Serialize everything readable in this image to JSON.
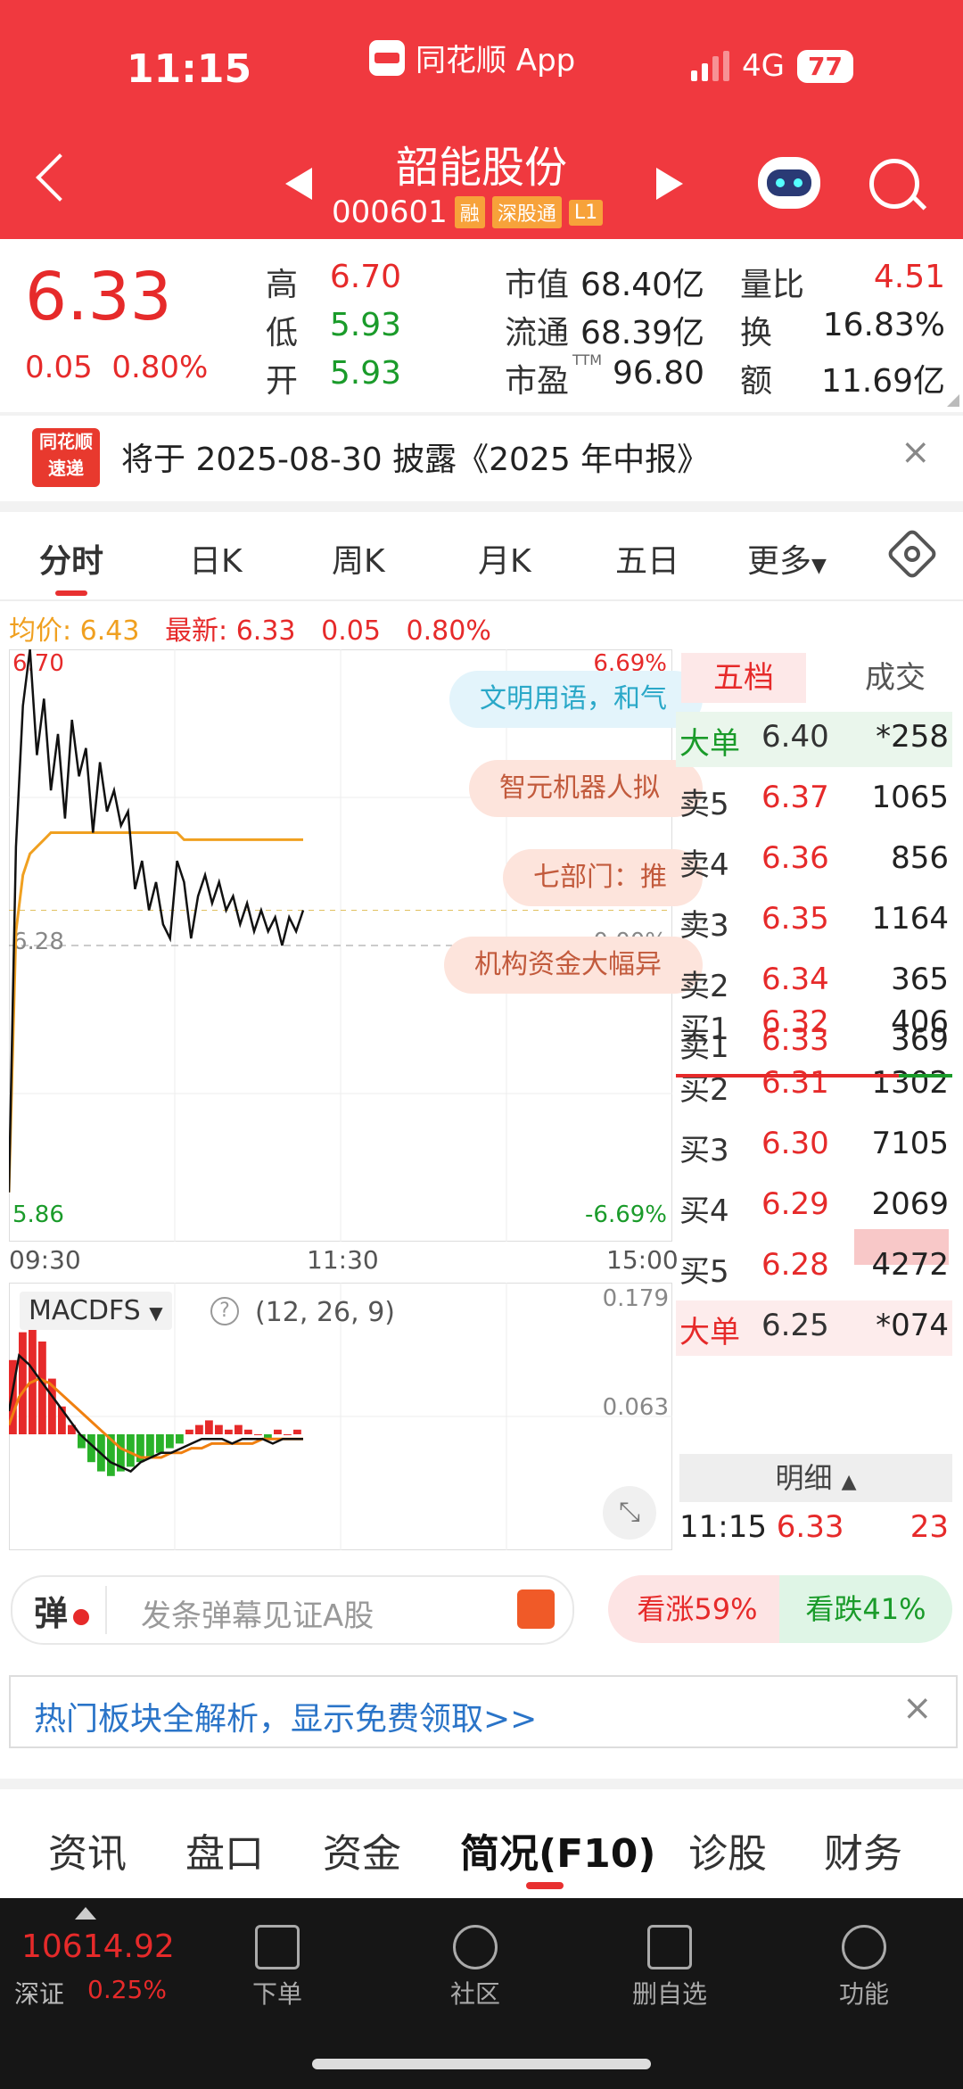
{
  "status_bar": {
    "time": "11:15",
    "app_name": "同花顺 App",
    "network": "4G",
    "battery": "77"
  },
  "header": {
    "stock_name": "韶能股份",
    "stock_code": "000601",
    "tags": [
      "融",
      "深股通",
      "L1"
    ]
  },
  "quote": {
    "price": "6.33",
    "change": "0.05",
    "change_pct": "0.80%",
    "stats": [
      {
        "label": "高",
        "value": "6.70",
        "color": "#e62a2a"
      },
      {
        "label": "低",
        "value": "5.93",
        "color": "#1a9b2a"
      },
      {
        "label": "开",
        "value": "5.93",
        "color": "#1a9b2a"
      },
      {
        "label": "市值",
        "value": "68.40亿"
      },
      {
        "label": "流通",
        "value": "68.39亿"
      },
      {
        "label": "市盈",
        "sup": "TTM",
        "value": "96.80"
      },
      {
        "label": "量比",
        "value": "4.51",
        "color": "#e62a2a"
      },
      {
        "label": "换",
        "value": "16.83%"
      },
      {
        "label": "额",
        "value": "11.69亿"
      }
    ]
  },
  "notice": {
    "logo_line1": "同花顺",
    "logo_line2": "速递",
    "text": "将于 2025-08-30 披露《2025 年中报》"
  },
  "tabs": [
    "分时",
    "日K",
    "周K",
    "月K",
    "五日",
    "更多"
  ],
  "chart_header": {
    "avg_label": "均价: 6.43",
    "latest_label": "最新: 6.33",
    "change": "0.05",
    "change_pct": "0.80%"
  },
  "chart_data": [
    {
      "type": "line",
      "y_top_label": "6.70",
      "y_mid_label": "6.28",
      "y_bottom_label": "5.86",
      "pct_top_label": "6.69%",
      "pct_mid_label": "0.00%",
      "pct_bottom_label": "-6.69%",
      "x_labels": [
        "09:30",
        "11:30",
        "15:00"
      ],
      "ylim": [
        5.86,
        6.7
      ],
      "series": [
        {
          "values": [
            5.93,
            6.42,
            6.62,
            6.7,
            6.55,
            6.63,
            6.5,
            6.58,
            6.46,
            6.6,
            6.52,
            6.56,
            6.44,
            6.54,
            6.47,
            6.5,
            6.45,
            6.47,
            6.36,
            6.4,
            6.33,
            6.37,
            6.31,
            6.29,
            6.4,
            6.37,
            6.29,
            6.35,
            6.38,
            6.34,
            6.37,
            6.33,
            6.35,
            6.31,
            6.34,
            6.3,
            6.33,
            6.3,
            6.32,
            6.28,
            6.32,
            6.3,
            6.33
          ]
        },
        {
          "values": [
            5.93,
            6.3,
            6.38,
            6.41,
            6.42,
            6.43,
            6.44,
            6.44,
            6.44,
            6.44,
            6.44,
            6.44,
            6.44,
            6.44,
            6.44,
            6.44,
            6.44,
            6.44,
            6.44,
            6.44,
            6.44,
            6.44,
            6.44,
            6.44,
            6.44,
            6.43,
            6.43,
            6.43,
            6.43,
            6.43,
            6.43,
            6.43,
            6.43,
            6.43,
            6.43,
            6.43,
            6.43,
            6.43,
            6.43,
            6.43,
            6.43,
            6.43,
            6.43
          ]
        }
      ]
    },
    {
      "type": "bar",
      "title": "MACDFS",
      "params": "(12, 26, 9)",
      "y_labels": [
        "0.179",
        "0.063"
      ],
      "histogram": [
        0.16,
        0.22,
        0.24,
        0.2,
        0.12,
        0.06,
        0.02,
        -0.03,
        -0.06,
        -0.08,
        -0.09,
        -0.08,
        -0.07,
        -0.06,
        -0.05,
        -0.04,
        -0.03,
        -0.02,
        0.01,
        0.02,
        0.03,
        0.02,
        0.01,
        0.02,
        0.01,
        0.0,
        -0.01,
        0.01,
        0.0,
        0.01
      ],
      "dif": [
        0.05,
        0.17,
        0.15,
        0.12,
        0.09,
        0.06,
        0.03,
        0.0,
        -0.02,
        -0.04,
        -0.06,
        -0.07,
        -0.08,
        -0.06,
        -0.05,
        -0.04,
        -0.04,
        -0.03,
        -0.02,
        -0.01,
        -0.01,
        -0.01,
        -0.02,
        -0.01,
        -0.01,
        -0.01,
        -0.02,
        -0.01,
        -0.01,
        -0.01
      ],
      "dea": [
        0.02,
        0.08,
        0.11,
        0.12,
        0.11,
        0.09,
        0.07,
        0.05,
        0.03,
        0.01,
        -0.01,
        -0.03,
        -0.04,
        -0.05,
        -0.05,
        -0.05,
        -0.04,
        -0.04,
        -0.03,
        -0.03,
        -0.02,
        -0.02,
        -0.02,
        -0.02,
        -0.02,
        -0.01,
        -0.01,
        -0.01,
        -0.01,
        -0.01
      ]
    }
  ],
  "news_pills": [
    {
      "text": "文明用语，和气",
      "bg": "#e3f4fb",
      "color": "#2aa8c8"
    },
    {
      "text": "智元机器人拟",
      "bg": "#fde4dc",
      "color": "#c25a3c"
    },
    {
      "text": "七部门：推",
      "bg": "#fde4dc",
      "color": "#c25a3c"
    },
    {
      "text": "机构资金大幅异",
      "bg": "#fde4dc",
      "color": "#c25a3c"
    }
  ],
  "order_book": {
    "tabs": [
      "五档",
      "成交"
    ],
    "big_sell": {
      "label": "大单",
      "price": "6.40",
      "vol": "*258"
    },
    "asks": [
      {
        "label": "卖5",
        "price": "6.37",
        "vol": "1065"
      },
      {
        "label": "卖4",
        "price": "6.36",
        "vol": "856"
      },
      {
        "label": "卖3",
        "price": "6.35",
        "vol": "1164"
      },
      {
        "label": "卖2",
        "price": "6.34",
        "vol": "365"
      },
      {
        "label": "卖1",
        "price": "6.33",
        "vol": "369"
      }
    ],
    "bids": [
      {
        "label": "买1",
        "price": "6.32",
        "vol": "406"
      },
      {
        "label": "买2",
        "price": "6.31",
        "vol": "1302"
      },
      {
        "label": "买3",
        "price": "6.30",
        "vol": "7105"
      },
      {
        "label": "买4",
        "price": "6.29",
        "vol": "2069"
      },
      {
        "label": "买5",
        "price": "6.28",
        "vol": "4272"
      }
    ],
    "big_buy": {
      "label": "大单",
      "price": "6.25",
      "vol": "*074"
    },
    "detail_label": "明细",
    "tick": {
      "time": "11:15",
      "price": "6.33",
      "vol": "23"
    }
  },
  "danmu": {
    "icon_char": "弹",
    "placeholder": "发条弹幕见证A股",
    "bull": "看涨59%",
    "bear": "看跌41%"
  },
  "promo": {
    "text": "热门板块全解析，显示免费领取>>"
  },
  "bottom_tabs": [
    "资讯",
    "盘口",
    "资金",
    "简况(F10)",
    "诊股",
    "财务"
  ],
  "index": {
    "value": "10614.92",
    "name": "深证",
    "pct": "0.25%"
  },
  "nav": [
    "下单",
    "社区",
    "删自选",
    "功能"
  ]
}
